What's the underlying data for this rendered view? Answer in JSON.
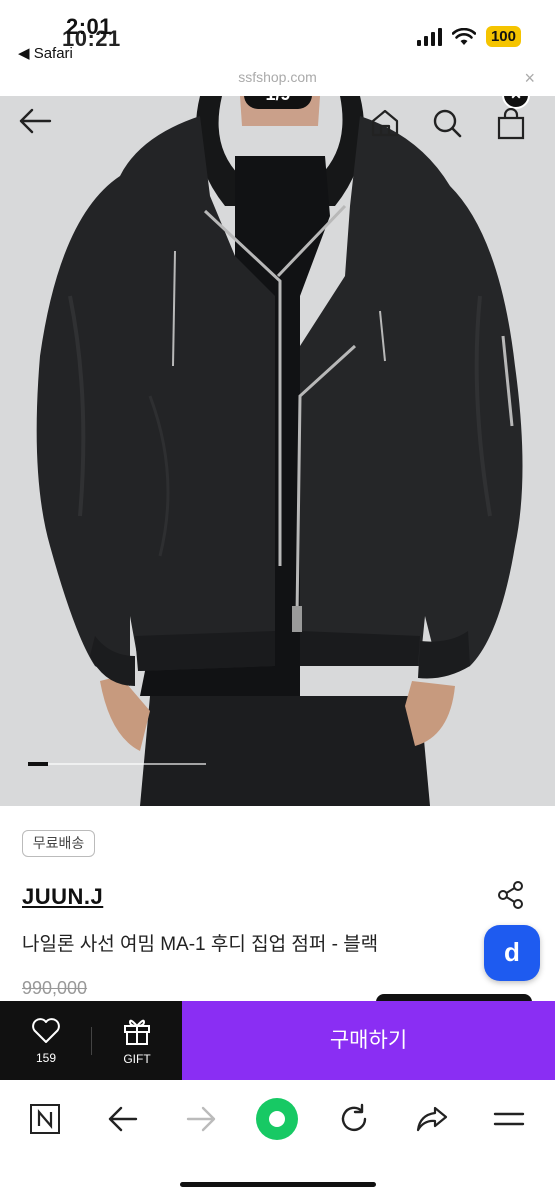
{
  "status_bar": {
    "time_primary": "2:01",
    "time_secondary": "10:21",
    "back_app": "◀ Safari",
    "battery": "100"
  },
  "url_bar": {
    "url": "ssfshop.com",
    "close_glyph": "×"
  },
  "gallery": {
    "counter": "1/9",
    "current_index": 1,
    "total": 9,
    "close_glyph": "×",
    "icons": [
      "back-arrow-icon",
      "home-icon",
      "search-icon",
      "shopping-bag-icon"
    ]
  },
  "product": {
    "shipping_badge": "무료배송",
    "brand": "JUUN.J",
    "name": "나일론 사선 여밈 MA-1 후디 집업 점퍼 - 블랙",
    "original_price": "990,000",
    "fab_label": "d"
  },
  "purchase_bar": {
    "like_count": "159",
    "gift_label": "GIFT",
    "buy_label": "구매하기",
    "buy_color": "#8a2ef3"
  },
  "browser_toolbar": {
    "items": [
      "n-icon",
      "back-arrow-icon",
      "forward-arrow-icon",
      "green-circle-icon",
      "reload-icon",
      "share-icon",
      "menu-icon"
    ],
    "accent": "#17c964"
  }
}
